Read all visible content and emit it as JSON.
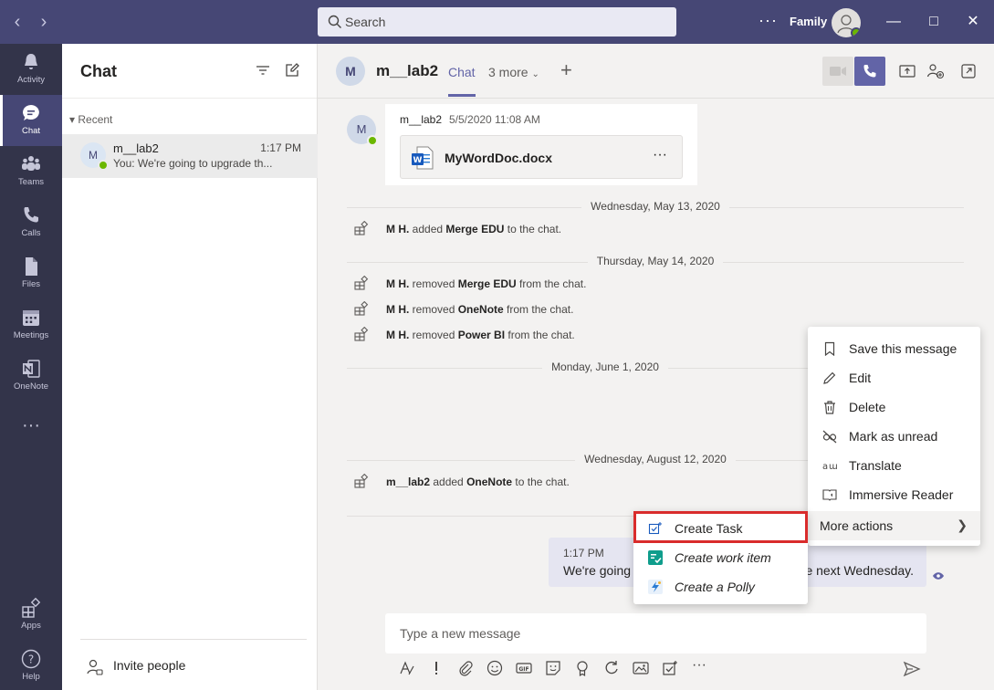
{
  "titlebar": {
    "search_placeholder": "Search",
    "more": "···",
    "profile_name": "Family",
    "window_controls": [
      "minimize",
      "maximize",
      "close"
    ]
  },
  "rail": {
    "items": [
      {
        "label": "Activity",
        "icon": "bell-icon"
      },
      {
        "label": "Chat",
        "icon": "chat-icon",
        "active": true
      },
      {
        "label": "Teams",
        "icon": "teams-icon"
      },
      {
        "label": "Calls",
        "icon": "phone-icon"
      },
      {
        "label": "Files",
        "icon": "file-icon"
      },
      {
        "label": "Meetings",
        "icon": "calendar-icon"
      },
      {
        "label": "OneNote",
        "icon": "onenote-icon"
      }
    ],
    "more": "···",
    "bottom": [
      {
        "label": "Apps",
        "icon": "apps-icon"
      },
      {
        "label": "Help",
        "icon": "help-icon"
      }
    ]
  },
  "chatlist": {
    "title": "Chat",
    "recent_label": "Recent",
    "row": {
      "initial": "M",
      "name": "m__lab2",
      "time": "1:17 PM",
      "preview": "You: We're going to upgrade th..."
    },
    "invite_label": "Invite people"
  },
  "main": {
    "header": {
      "initial": "M",
      "name": "m__lab2",
      "tab_chat": "Chat",
      "tab_more": "3 more",
      "plus": "+"
    },
    "first_message": {
      "initial": "M",
      "sender": "m__lab2",
      "timestamp": "5/5/2020 11:08 AM",
      "file_name": "MyWordDoc.docx",
      "file_more": "···"
    },
    "dividers": [
      "Wednesday, May 13, 2020",
      "Thursday, May 14, 2020",
      "Monday, June 1, 2020",
      "Wednesday, August 12, 2020"
    ],
    "events": [
      {
        "actor": "M H.",
        "verb": " added ",
        "object": "Merge EDU",
        "tail": " to the chat."
      },
      {
        "actor": "M H.",
        "verb": " removed ",
        "object": "Merge EDU",
        "tail": " from the chat."
      },
      {
        "actor": "M H.",
        "verb": " removed ",
        "object": "OneNote",
        "tail": " from the chat."
      },
      {
        "actor": "M H.",
        "verb": " removed ",
        "object": "Power BI",
        "tail": " from the chat."
      },
      {
        "actor": "m__lab2",
        "verb": " added ",
        "object": "OneNote",
        "tail": " to the chat."
      }
    ],
    "sent_message": {
      "time": "1:17 PM",
      "text_start": "We're going",
      "text_end": "e next Wednesday."
    },
    "compose_placeholder": "Type a new message"
  },
  "context_menu": {
    "items": [
      {
        "label": "Save this message",
        "icon": "bookmark-icon"
      },
      {
        "label": "Edit",
        "icon": "pencil-icon"
      },
      {
        "label": "Delete",
        "icon": "trash-icon"
      },
      {
        "label": "Mark as unread",
        "icon": "unread-icon"
      },
      {
        "label": "Translate",
        "icon": "translate-icon"
      },
      {
        "label": "Immersive Reader",
        "icon": "immersive-reader-icon"
      }
    ],
    "more_actions": "More actions"
  },
  "submenu": {
    "items": [
      {
        "label": "Create Task",
        "icon": "task-icon"
      },
      {
        "label": "Create work item",
        "icon": "work-item-icon"
      },
      {
        "label": "Create a Polly",
        "icon": "polly-icon"
      }
    ]
  },
  "colors": {
    "titlebar": "#464775",
    "rail": "#33344a",
    "accent": "#6264a7",
    "presence": "#6bb700",
    "highlight_border": "#d92c2c"
  }
}
